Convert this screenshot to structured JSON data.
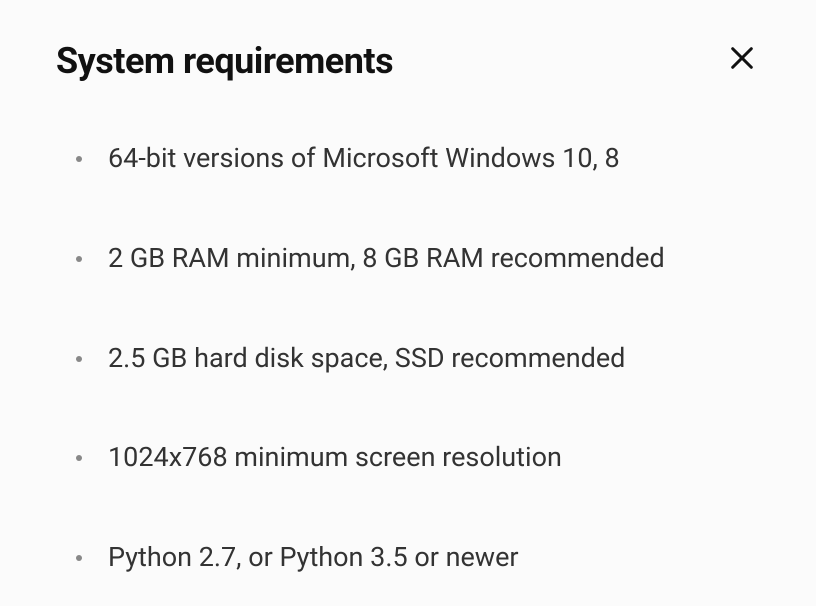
{
  "header": {
    "title": "System requirements"
  },
  "requirements": [
    "64-bit versions of Microsoft Windows 10, 8",
    "2 GB RAM minimum, 8 GB RAM recommended",
    "2.5 GB hard disk space, SSD recommended",
    "1024x768 minimum screen resolution",
    "Python 2.7, or Python 3.5 or newer"
  ]
}
